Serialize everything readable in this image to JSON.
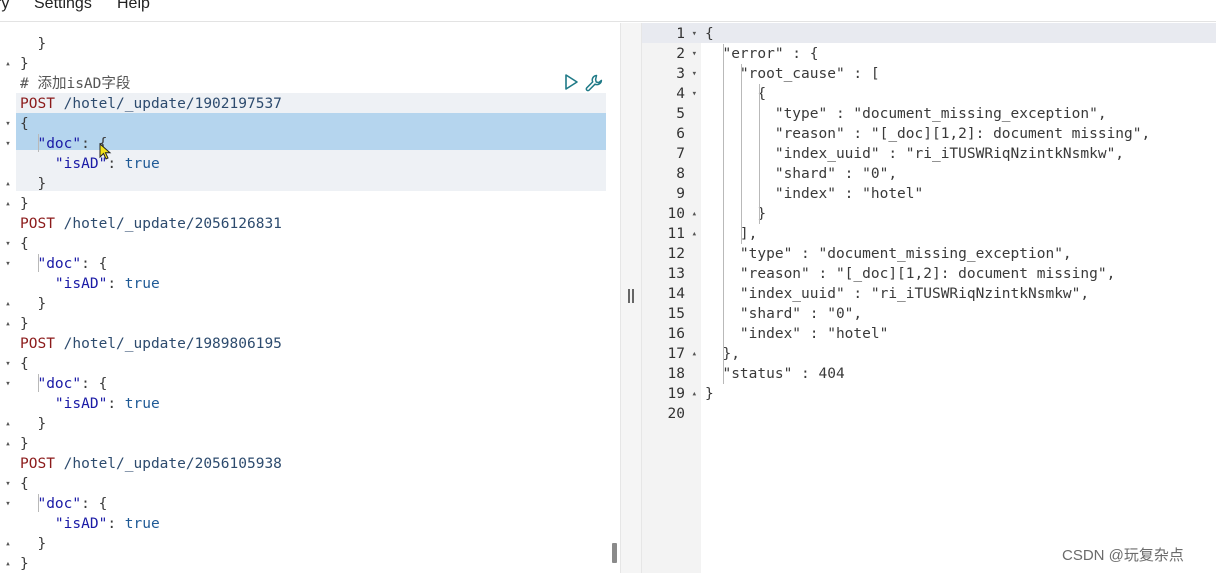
{
  "menubar": {
    "items": [
      {
        "label": "ry"
      },
      {
        "label": "Settings"
      },
      {
        "label": "Help"
      }
    ]
  },
  "editor": {
    "lines": [
      {
        "fold": "",
        "text": "  }"
      },
      {
        "fold": "▴",
        "text": "}"
      },
      {
        "fold": "",
        "comment": "# 添加isAD字段"
      },
      {
        "fold": "",
        "method": "POST",
        "url": "/hotel/_update/1902197537"
      },
      {
        "fold": "▾",
        "text": "{"
      },
      {
        "fold": "▾",
        "indent": "  ",
        "key": "\"doc\"",
        "rest": ": {"
      },
      {
        "fold": "",
        "indent": "    ",
        "key": "\"isAD\"",
        "rest": ": ",
        "bool": "true"
      },
      {
        "fold": "▴",
        "text": "  }"
      },
      {
        "fold": "▴",
        "text": "}"
      },
      {
        "fold": "",
        "method": "POST",
        "url": "/hotel/_update/2056126831"
      },
      {
        "fold": "▾",
        "text": "{"
      },
      {
        "fold": "▾",
        "indent": "  ",
        "key": "\"doc\"",
        "rest": ": {"
      },
      {
        "fold": "",
        "indent": "    ",
        "key": "\"isAD\"",
        "rest": ": ",
        "bool": "true"
      },
      {
        "fold": "▴",
        "text": "  }"
      },
      {
        "fold": "▴",
        "text": "}"
      },
      {
        "fold": "",
        "method": "POST",
        "url": "/hotel/_update/1989806195"
      },
      {
        "fold": "▾",
        "text": "{"
      },
      {
        "fold": "▾",
        "indent": "  ",
        "key": "\"doc\"",
        "rest": ": {"
      },
      {
        "fold": "",
        "indent": "    ",
        "key": "\"isAD\"",
        "rest": ": ",
        "bool": "true"
      },
      {
        "fold": "▴",
        "text": "  }"
      },
      {
        "fold": "▴",
        "text": "}"
      },
      {
        "fold": "",
        "method": "POST",
        "url": "/hotel/_update/2056105938"
      },
      {
        "fold": "▾",
        "text": "{"
      },
      {
        "fold": "▾",
        "indent": "  ",
        "key": "\"doc\"",
        "rest": ": {"
      },
      {
        "fold": "",
        "indent": "    ",
        "key": "\"isAD\"",
        "rest": ": ",
        "bool": "true"
      },
      {
        "fold": "▴",
        "text": "  }"
      },
      {
        "fold": "▴",
        "text": "}"
      }
    ]
  },
  "output": {
    "lines": [
      {
        "n": "1",
        "fold": "▾",
        "text": "{"
      },
      {
        "n": "2",
        "fold": "▾",
        "text": "  \"error\" : {"
      },
      {
        "n": "3",
        "fold": "▾",
        "text": "    \"root_cause\" : ["
      },
      {
        "n": "4",
        "fold": "▾",
        "text": "      {"
      },
      {
        "n": "5",
        "fold": "",
        "text": "        \"type\" : \"document_missing_exception\","
      },
      {
        "n": "6",
        "fold": "",
        "text": "        \"reason\" : \"[_doc][1,2]: document missing\","
      },
      {
        "n": "7",
        "fold": "",
        "text": "        \"index_uuid\" : \"ri_iTUSWRiqNzintkNsmkw\","
      },
      {
        "n": "8",
        "fold": "",
        "text": "        \"shard\" : \"0\","
      },
      {
        "n": "9",
        "fold": "",
        "text": "        \"index\" : \"hotel\""
      },
      {
        "n": "10",
        "fold": "▴",
        "text": "      }"
      },
      {
        "n": "11",
        "fold": "▴",
        "text": "    ],"
      },
      {
        "n": "12",
        "fold": "",
        "text": "    \"type\" : \"document_missing_exception\","
      },
      {
        "n": "13",
        "fold": "",
        "text": "    \"reason\" : \"[_doc][1,2]: document missing\","
      },
      {
        "n": "14",
        "fold": "",
        "text": "    \"index_uuid\" : \"ri_iTUSWRiqNzintkNsmkw\","
      },
      {
        "n": "15",
        "fold": "",
        "text": "    \"shard\" : \"0\","
      },
      {
        "n": "16",
        "fold": "",
        "text": "    \"index\" : \"hotel\""
      },
      {
        "n": "17",
        "fold": "▴",
        "text": "  },"
      },
      {
        "n": "18",
        "fold": "",
        "text": "  \"status\" : 404"
      },
      {
        "n": "19",
        "fold": "▴",
        "text": "}"
      },
      {
        "n": "20",
        "fold": "",
        "text": ""
      }
    ]
  },
  "icons": {
    "play": "play-icon",
    "wrench": "wrench-icon"
  },
  "watermark": "CSDN @玩复杂点",
  "colors": {
    "selection": "#b5d5ee",
    "request_band": "#eef1f5",
    "method": "#8b1a1a",
    "json_key": "#1a1aa6"
  }
}
